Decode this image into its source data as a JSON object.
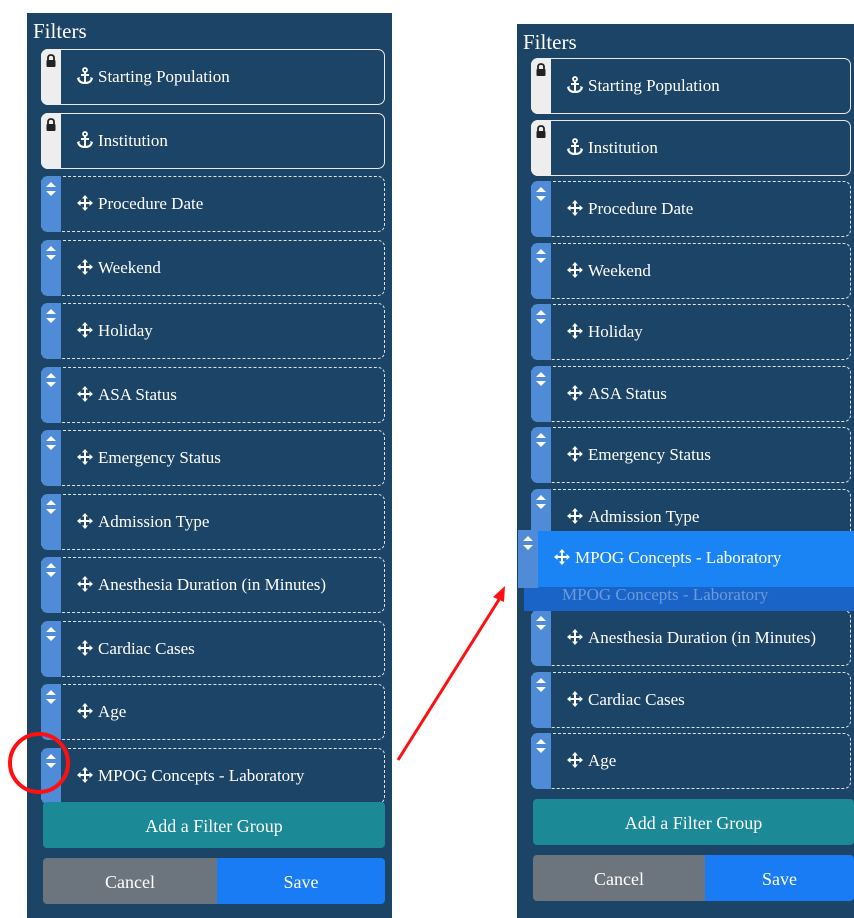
{
  "left_panel": {
    "title": "Filters",
    "items": [
      {
        "label": "Starting Population",
        "locked": true,
        "icon": "anchor-icon"
      },
      {
        "label": "Institution",
        "locked": true,
        "icon": "anchor-icon"
      },
      {
        "label": "Procedure Date",
        "locked": false,
        "icon": "move-icon"
      },
      {
        "label": "Weekend",
        "locked": false,
        "icon": "move-icon"
      },
      {
        "label": "Holiday",
        "locked": false,
        "icon": "move-icon"
      },
      {
        "label": "ASA Status",
        "locked": false,
        "icon": "move-icon"
      },
      {
        "label": "Emergency Status",
        "locked": false,
        "icon": "move-icon"
      },
      {
        "label": "Admission Type",
        "locked": false,
        "icon": "move-icon"
      },
      {
        "label": "Anesthesia Duration (in Minutes)",
        "locked": false,
        "icon": "move-icon"
      },
      {
        "label": "Cardiac Cases",
        "locked": false,
        "icon": "move-icon"
      },
      {
        "label": "Age",
        "locked": false,
        "icon": "move-icon"
      },
      {
        "label": "MPOG Concepts - Laboratory",
        "locked": false,
        "icon": "move-icon"
      }
    ],
    "add_group_label": "Add a Filter Group",
    "cancel_label": "Cancel",
    "save_label": "Save"
  },
  "right_panel": {
    "title": "Filters",
    "items": [
      {
        "label": "Starting Population",
        "locked": true,
        "icon": "anchor-icon"
      },
      {
        "label": "Institution",
        "locked": true,
        "icon": "anchor-icon"
      },
      {
        "label": "Procedure Date",
        "locked": false,
        "icon": "move-icon"
      },
      {
        "label": "Weekend",
        "locked": false,
        "icon": "move-icon"
      },
      {
        "label": "Holiday",
        "locked": false,
        "icon": "move-icon"
      },
      {
        "label": "ASA Status",
        "locked": false,
        "icon": "move-icon"
      },
      {
        "label": "Emergency Status",
        "locked": false,
        "icon": "move-icon"
      },
      {
        "label": "Admission Type",
        "locked": false,
        "icon": "move-icon"
      },
      {
        "label": "Anesthesia Duration (in Minutes)",
        "locked": false,
        "icon": "move-icon"
      },
      {
        "label": "Cardiac Cases",
        "locked": false,
        "icon": "move-icon"
      },
      {
        "label": "Age",
        "locked": false,
        "icon": "move-icon"
      }
    ],
    "dragging_item": {
      "label": "MPOG Concepts - Laboratory",
      "icon": "move-icon"
    },
    "drag_placeholder": {
      "label": "MPOG Concepts - Laboratory"
    },
    "add_group_label": "Add a Filter Group",
    "cancel_label": "Cancel",
    "save_label": "Save"
  },
  "annotations": {
    "highlight_color": "#ff1010",
    "highlight_target": "drag-handle",
    "arrow_direction": "left-to-right"
  },
  "colors": {
    "panel_bg": "#1c4466",
    "drag_handle": "#4f8bd6",
    "add_group_btn": "#1b8a96",
    "cancel_btn": "#6c757d",
    "save_btn": "#1a7cf5",
    "dragging_bg": "#1a84f5"
  }
}
